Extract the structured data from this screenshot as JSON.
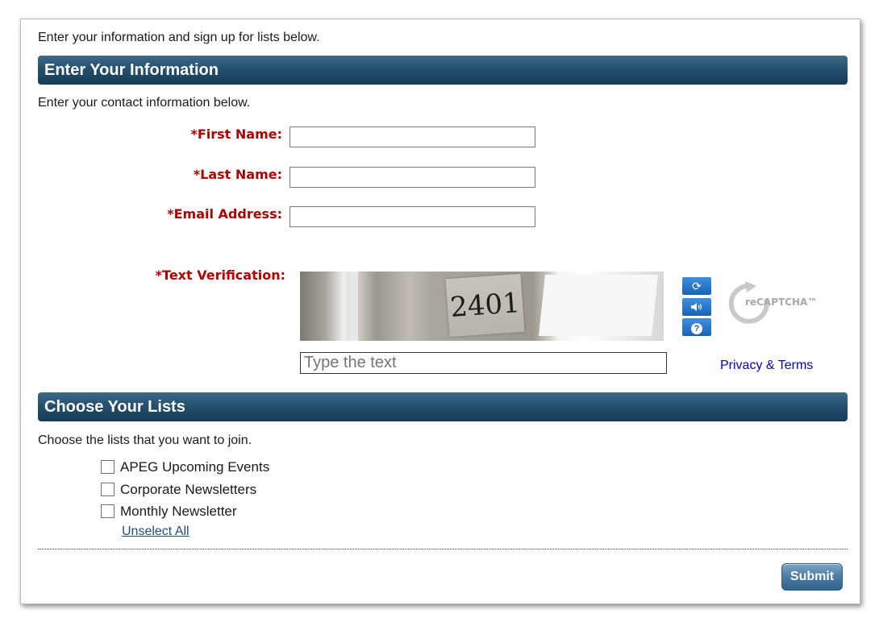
{
  "intro_text": "Enter your information and sign up for lists below.",
  "info_section": {
    "header": "Enter Your Information",
    "subtext": "Enter your contact information below.",
    "first_name_label": "*First Name:",
    "last_name_label": "*Last Name:",
    "email_label": "*Email Address:",
    "first_name_value": "",
    "last_name_value": "",
    "email_value": "",
    "verification_label": "*Text Verification:"
  },
  "captcha": {
    "image_text": "2401",
    "input_placeholder": "Type the text",
    "refresh_icon": "refresh-icon",
    "audio_icon": "audio-icon",
    "help_icon": "help-icon",
    "logo_text": "reCAPTCHA™",
    "privacy_link": "Privacy & Terms"
  },
  "lists_section": {
    "header": "Choose Your Lists",
    "subtext": "Choose the lists that you want to join.",
    "items": [
      {
        "label": "APEG Upcoming Events",
        "checked": false
      },
      {
        "label": "Corporate Newsletters",
        "checked": false
      },
      {
        "label": "Monthly Newsletter",
        "checked": false
      }
    ],
    "unselect_all": "Unselect All"
  },
  "submit_label": "Submit",
  "colors": {
    "header_bg": "#234e6c",
    "required_label": "#b00000",
    "link": "#0000d4",
    "submit_bg": "#4f7fa7"
  }
}
